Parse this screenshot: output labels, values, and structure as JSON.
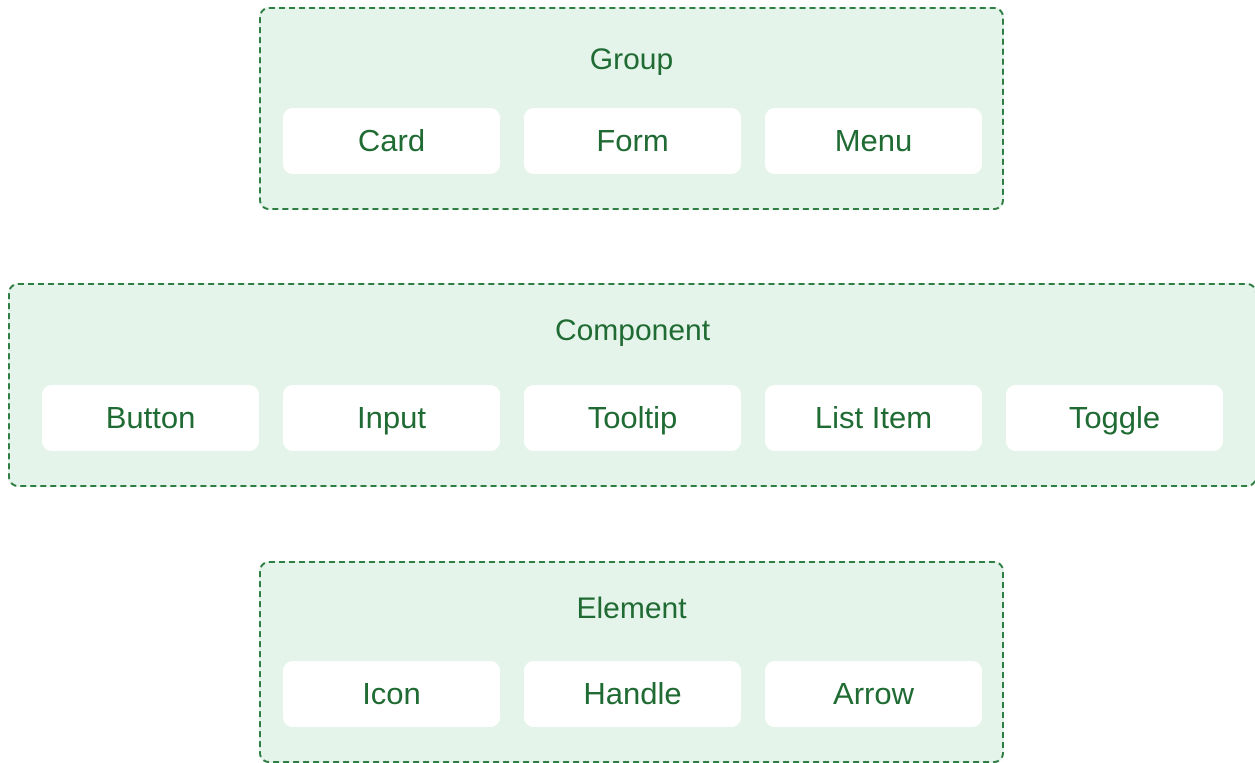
{
  "colors": {
    "group_fill": "#e5f4ea",
    "group_border": "#2e7d43",
    "text": "#1f6b33",
    "item_fill": "#ffffff"
  },
  "groups": [
    {
      "title": "Group",
      "items": [
        "Card",
        "Form",
        "Menu"
      ]
    },
    {
      "title": "Component",
      "items": [
        "Button",
        "Input",
        "Tooltip",
        "List Item",
        "Toggle"
      ]
    },
    {
      "title": "Element",
      "items": [
        "Icon",
        "Handle",
        "Arrow"
      ]
    }
  ]
}
